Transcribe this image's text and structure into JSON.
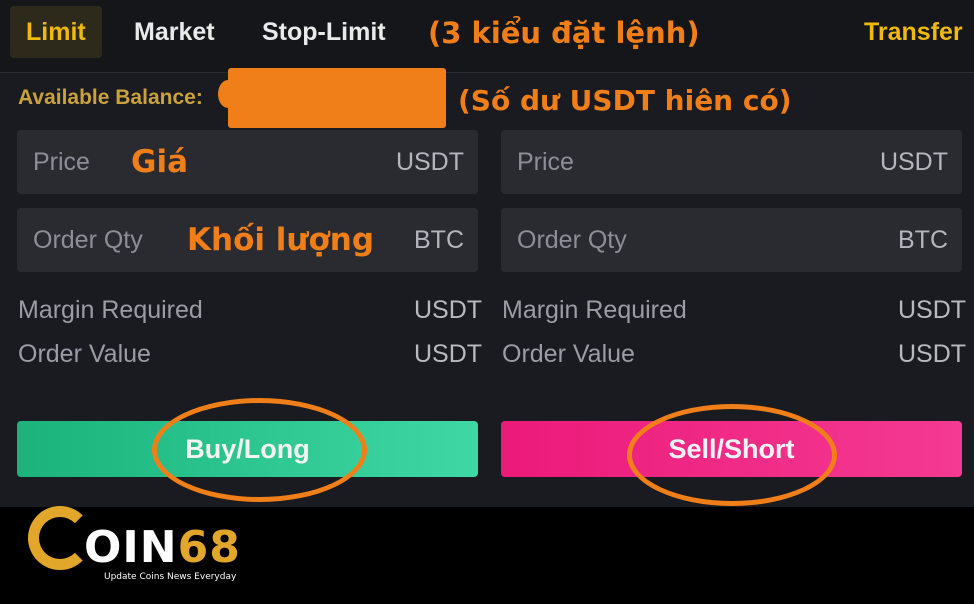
{
  "tabs": {
    "limit": "Limit",
    "market": "Market",
    "stop_limit": "Stop-Limit",
    "transfer": "Transfer"
  },
  "annotations": {
    "order_types": "(3 kiểu đặt lệnh)",
    "balance": "(Số dư USDT hiên có)",
    "price": "Giá",
    "qty": "Khối lượng"
  },
  "balance": {
    "label": "Available Balance:"
  },
  "buy_form": {
    "price_label": "Price",
    "price_unit": "USDT",
    "qty_label": "Order Qty",
    "qty_unit": "BTC",
    "margin_label": "Margin Required",
    "margin_unit": "USDT",
    "value_label": "Order Value",
    "value_unit": "USDT",
    "button": "Buy/Long"
  },
  "sell_form": {
    "price_label": "Price",
    "price_unit": "USDT",
    "qty_label": "Order Qty",
    "qty_unit": "BTC",
    "margin_label": "Margin Required",
    "margin_unit": "USDT",
    "value_label": "Order Value",
    "value_unit": "USDT",
    "button": "Sell/Short"
  },
  "logo": {
    "name_part1": "OIN",
    "name_part2": "68",
    "tagline": "Update Coins News Everyday"
  },
  "colors": {
    "accent": "#f0b90b",
    "annotation": "#f07f1a",
    "buy": "#1bb37b",
    "sell": "#ec1a7a"
  }
}
